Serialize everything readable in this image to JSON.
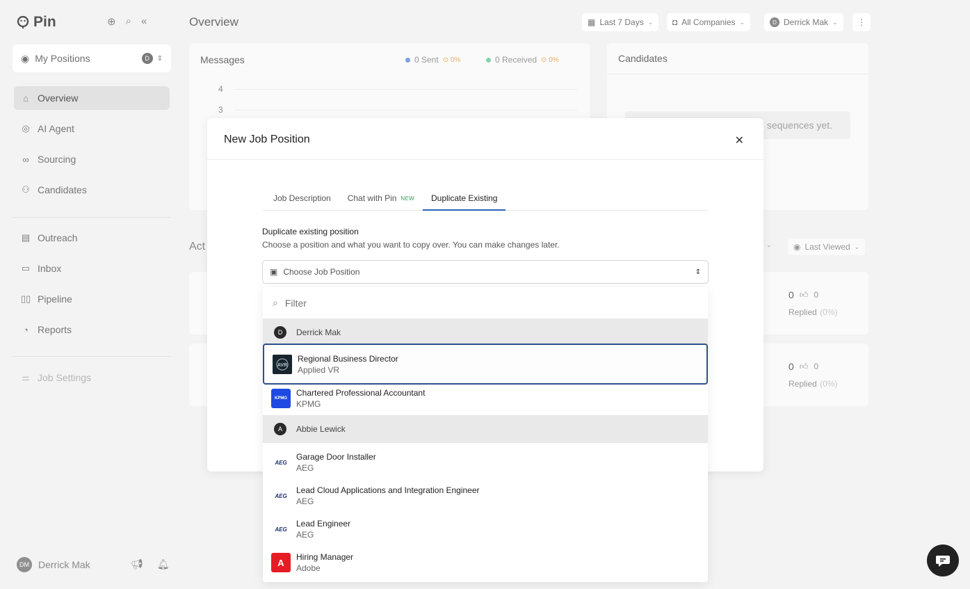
{
  "brand": {
    "name": "Pin"
  },
  "sidebar": {
    "positions_label": "My Positions",
    "positions_badge": "D",
    "items": [
      {
        "label": "Overview",
        "icon": "home-icon"
      },
      {
        "label": "AI Agent",
        "icon": "ai-agent-icon"
      },
      {
        "label": "Sourcing",
        "icon": "binoculars-icon"
      },
      {
        "label": "Candidates",
        "icon": "users-icon"
      },
      {
        "label": "Outreach",
        "icon": "outreach-icon"
      },
      {
        "label": "Inbox",
        "icon": "inbox-icon"
      },
      {
        "label": "Pipeline",
        "icon": "pipeline-icon"
      },
      {
        "label": "Reports",
        "icon": "pie-chart-icon"
      },
      {
        "label": "Job Settings",
        "icon": "sliders-icon"
      }
    ],
    "user": {
      "name": "Derrick Mak",
      "initials": "DM"
    }
  },
  "header": {
    "title": "Overview",
    "date_range": "Last 7 Days",
    "companies": "All Companies",
    "user_filter": "Derrick Mak",
    "user_initial": "D"
  },
  "messages_card": {
    "title": "Messages",
    "sent": "0 Sent",
    "sent_pct": "0%",
    "received": "0 Received",
    "received_pct": "0%",
    "y_ticks": [
      "4",
      "3"
    ]
  },
  "candidates_card": {
    "title": "Candidates",
    "empty_text": "sequences yet."
  },
  "activity": {
    "title": "Act",
    "sort_label": "Last Viewed",
    "rows": [
      {
        "count": "0",
        "likes": "0",
        "label": "Replied",
        "pct": "(0%)"
      },
      {
        "count": "0",
        "likes": "0",
        "label": "Replied",
        "pct": "(0%)"
      }
    ]
  },
  "modal": {
    "title": "New Job Position",
    "tabs": {
      "job_description": "Job Description",
      "chat_with_pin": "Chat with Pin",
      "new_badge": "NEW",
      "duplicate_existing": "Duplicate Existing"
    },
    "field_label": "Duplicate existing position",
    "field_help": "Choose a position and what you want to copy over. You can make changes later.",
    "select_placeholder": "Choose Job Position"
  },
  "dropdown": {
    "filter_placeholder": "Filter",
    "groups": [
      {
        "owner": "Derrick Mak",
        "initial": "D"
      },
      {
        "owner": "Abbie Lewick",
        "initial": "A"
      }
    ],
    "options": [
      {
        "title": "Regional Business Director",
        "company": "Applied VR",
        "logo": "AVR"
      },
      {
        "title": "Chartered Professional Accountant",
        "company": "KPMG",
        "logo": "KPMG"
      },
      {
        "title": "Garage Door Installer",
        "company": "AEG",
        "logo": "AEG"
      },
      {
        "title": "Lead Cloud Applications and Integration Engineer",
        "company": "AEG",
        "logo": "AEG"
      },
      {
        "title": "Lead Engineer",
        "company": "AEG",
        "logo": "AEG"
      },
      {
        "title": "Hiring Manager",
        "company": "Adobe",
        "logo": "A"
      }
    ]
  },
  "colors": {
    "accent": "#2b5fb5",
    "selected_border": "#2f4f8a",
    "sent_dot": "#7da2e0",
    "received_dot": "#7fd4ad",
    "pct": "#e6b04b",
    "kpmg": "#1e49e2",
    "adobe": "#e61c24"
  }
}
